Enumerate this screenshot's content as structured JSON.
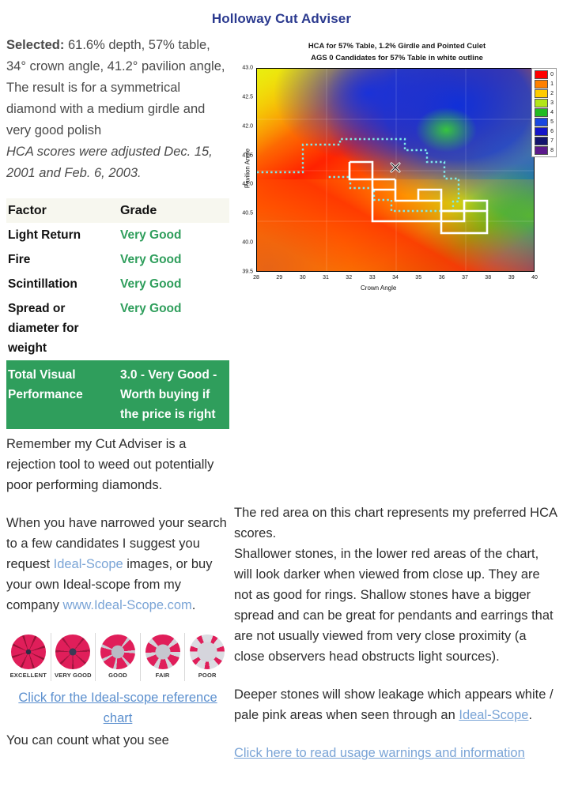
{
  "page": {
    "title": "Holloway Cut Adviser"
  },
  "selected": {
    "label": "Selected:",
    "values": "61.6% depth, 57% table, 34° crown angle, 41.2° pavilion angle,",
    "description": "The result is for a symmetrical diamond with a medium girdle and very good polish",
    "note": "HCA scores were adjusted Dec. 15, 2001 and Feb. 6, 2003."
  },
  "results_table": {
    "headers": [
      "Factor",
      "Grade"
    ],
    "rows": [
      {
        "factor": "Light Return",
        "grade": "Very Good"
      },
      {
        "factor": "Fire",
        "grade": "Very Good"
      },
      {
        "factor": "Scintillation",
        "grade": "Very Good"
      },
      {
        "factor": "Spread or diameter for weight",
        "grade": "Very Good"
      }
    ],
    "total": {
      "factor": "Total Visual Performance",
      "grade": "3.0 - Very Good - Worth buying if the price is right"
    },
    "grade_color": "#2f9e5c",
    "total_bg": "#2f9e5c"
  },
  "left_text": {
    "para1": "Remember my Cut Adviser is a rejection tool to weed out potentially poor performing diamonds.",
    "para2_pre": "When you have narrowed your search to a few candidates I suggest you request ",
    "para2_link1": "Ideal-Scope",
    "para2_mid": " images, or buy your own Ideal-scope from my company ",
    "para2_link2": "www.Ideal-Scope.com",
    "para2_post": "."
  },
  "scope_strip": {
    "items": [
      {
        "label": "EXCELLENT"
      },
      {
        "label": "VERY GOOD"
      },
      {
        "label": "GOOD"
      },
      {
        "label": "FAIR"
      },
      {
        "label": "POOR"
      }
    ],
    "cta": "Click for the Ideal-scope reference chart",
    "cut_off_text": "You can count what you see"
  },
  "right_text": {
    "para1": "The red area on this chart represents my preferred HCA scores.\nShallower stones, in the lower red areas of the chart, will look darker when viewed from close up. They are not as good for rings. Shallow stones have a bigger spread and can be great for pendants and earrings that are not usually viewed from very close proximity (a close observers head obstructs light sources).",
    "para2_pre": "Deeper stones will show leakage which appears white / pale pink areas when seen through an ",
    "para2_link": "Ideal-Scope",
    "para2_post": ".",
    "warning_link": "Click here to read usage warnings and information"
  },
  "chart_data": {
    "type": "heatmap",
    "title": "HCA for 57% Table, 1.2% Girdle and Pointed Culet",
    "subtitle": "AGS 0 Candidates for 57% Table in white outline",
    "xlabel": "Crown Angle",
    "ylabel": "Pavilion Angle",
    "xlim": [
      28,
      40
    ],
    "ylim": [
      39.5,
      43.0
    ],
    "xticks": [
      "28",
      "29",
      "30",
      "31",
      "32",
      "33",
      "34",
      "35",
      "36",
      "37",
      "38",
      "39",
      "40"
    ],
    "yticks": [
      "39.5",
      "40.0",
      "40.5",
      "41.0",
      "41.5",
      "42.0",
      "42.5",
      "43.0"
    ],
    "legend_position": "right",
    "legend": [
      {
        "value": "0",
        "color": "#ff0000"
      },
      {
        "value": "1",
        "color": "#ff8000"
      },
      {
        "value": "2",
        "color": "#ffcc00"
      },
      {
        "value": "3",
        "color": "#b3e619"
      },
      {
        "value": "4",
        "color": "#22bb22"
      },
      {
        "value": "5",
        "color": "#1a47e0"
      },
      {
        "value": "6",
        "color": "#1414c8"
      },
      {
        "value": "7",
        "color": "#14146e"
      },
      {
        "value": "8",
        "color": "#5c1a8c"
      }
    ],
    "marker": {
      "symbol": "X",
      "x": 34,
      "y": 41.2,
      "label": "selected diamond"
    },
    "annotations": [
      "White stepped outline marks AGS 0 candidates for 57% table",
      "Cyan dotted stepped line marks a secondary boundary region"
    ]
  }
}
